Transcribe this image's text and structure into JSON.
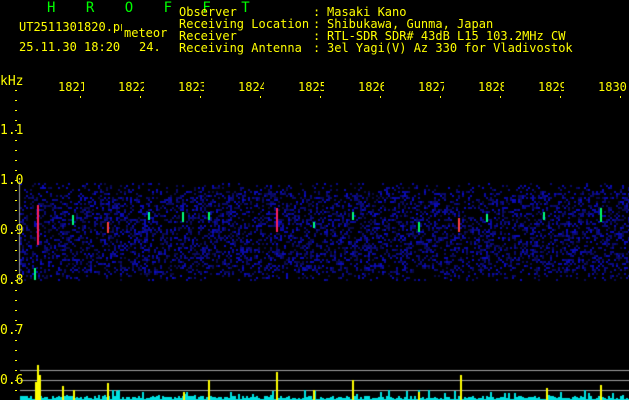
{
  "header": {
    "app_title": "H R O F F T",
    "filename": "UT2511301820.png",
    "mode": "meteor",
    "datetime": "25.11.30 18:20",
    "value": "24.",
    "fields": [
      {
        "label": "Observer",
        "value": "Masaki Kano"
      },
      {
        "label": "Receiving Location",
        "value": "Shibukawa, Gunma, Japan"
      },
      {
        "label": "Receiver",
        "value": "RTL-SDR SDR# 43dB L15 103.2MHz CW"
      },
      {
        "label": "Receiving Antenna",
        "value": "3el Yagi(V) Az 330 for Vladivostok"
      }
    ]
  },
  "axes": {
    "y_unit": "kHz",
    "y_labels": [
      "1.1",
      "1.0",
      "0.9",
      "0.8",
      "0.7",
      "0.6"
    ],
    "x_labels": [
      "1821",
      "1822",
      "1823",
      "1824",
      "1825",
      "1826",
      "1827",
      "1828",
      "1829",
      "1830"
    ]
  },
  "colors": {
    "text": "#ffff00",
    "title": "#00ff00",
    "noise": "#1a1aa0",
    "histogram": "#00e0e0",
    "spike": "#ffff00",
    "grid": "#a0a0a0"
  }
}
